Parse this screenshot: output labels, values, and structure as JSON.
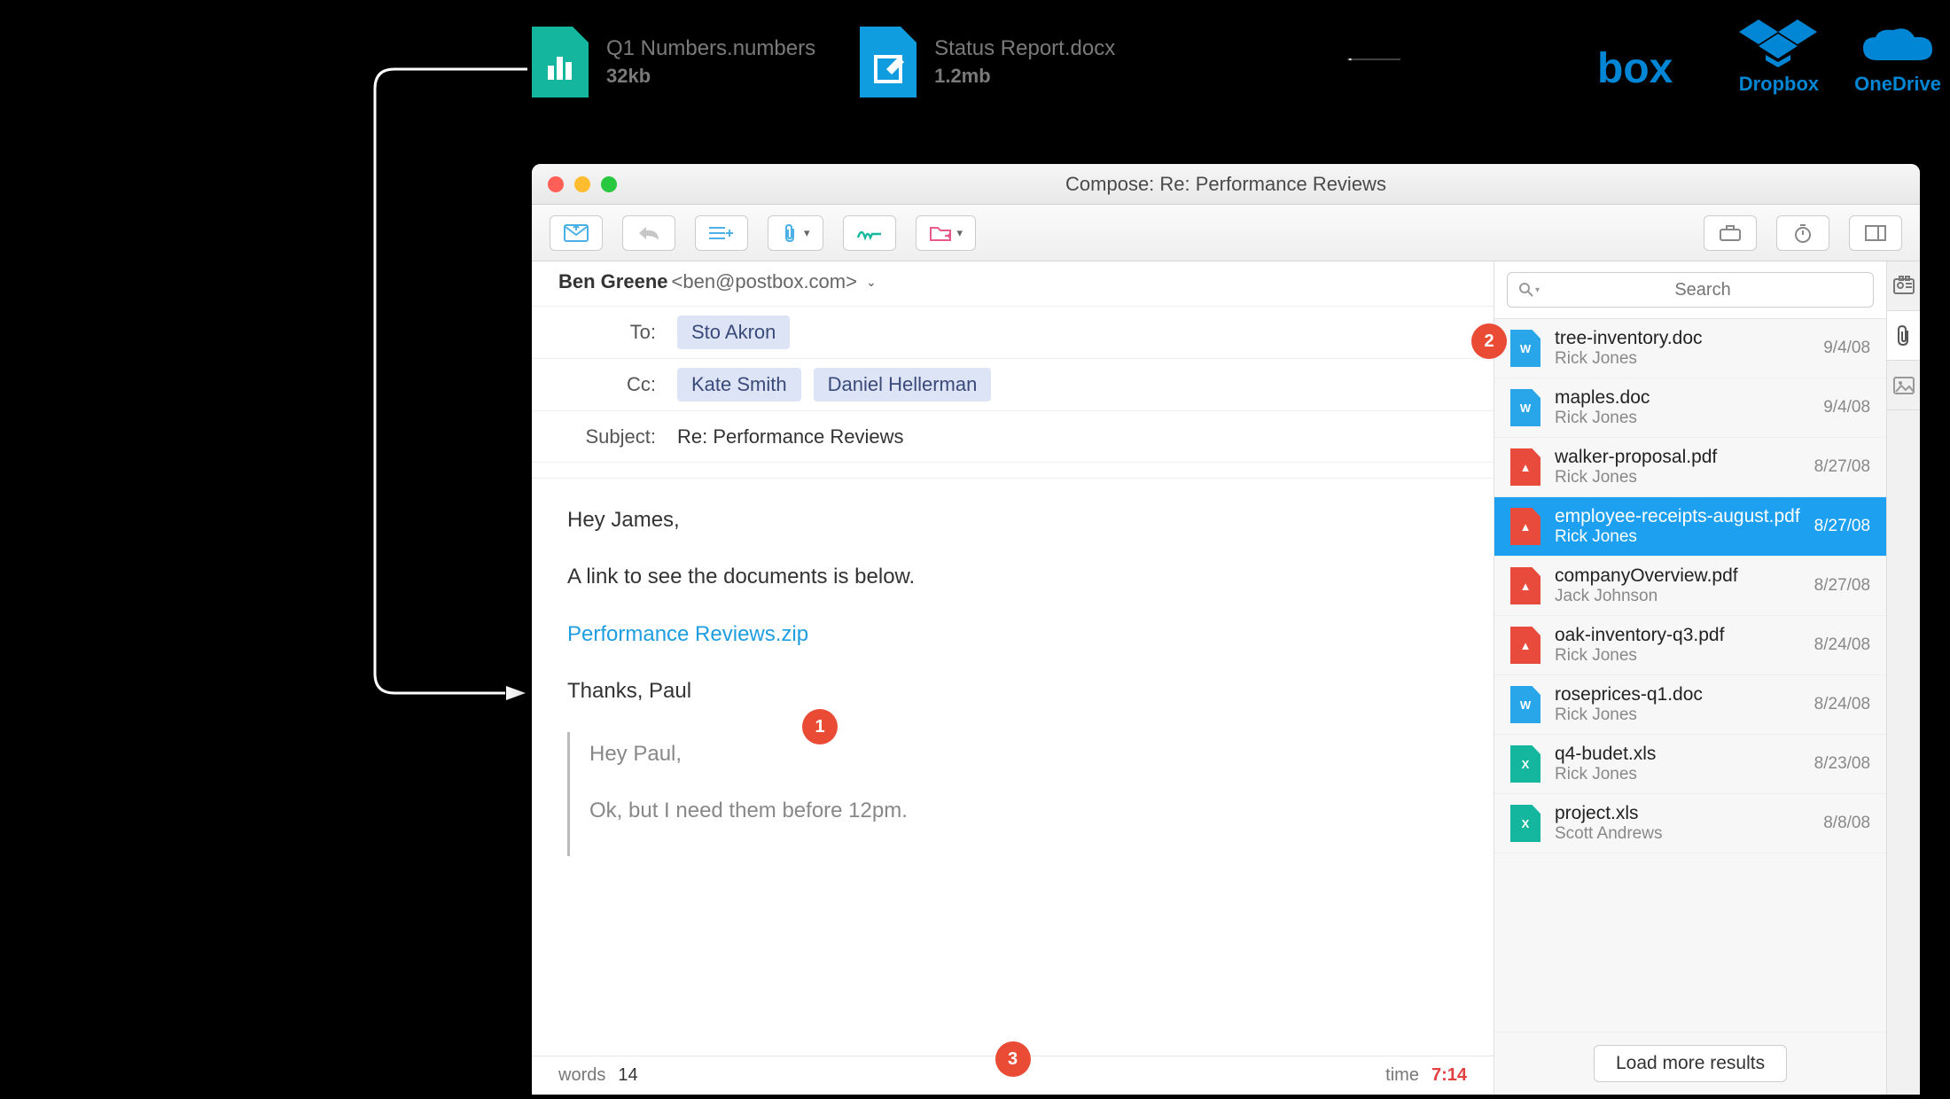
{
  "top_files": [
    {
      "name": "Q1 Numbers.numbers",
      "size": "32kb",
      "icon_color": "#14b79d",
      "glyph": "chart"
    },
    {
      "name": "Status Report.docx",
      "size": "1.2mb",
      "icon_color": "#0f9de0",
      "glyph": "edit"
    }
  ],
  "providers": [
    {
      "name": "box",
      "label": ""
    },
    {
      "name": "dropbox",
      "label": "Dropbox"
    },
    {
      "name": "onedrive",
      "label": "OneDrive"
    }
  ],
  "window": {
    "title": "Compose: Re: Performance Reviews",
    "from_name": "Ben Greene",
    "from_addr": "<ben@postbox.com>",
    "to": [
      "Sto Akron"
    ],
    "cc": [
      "Kate Smith",
      "Daniel Hellerman"
    ],
    "subject_label": "Subject:",
    "to_label": "To:",
    "cc_label": "Cc:",
    "subject": "Re: Performance Reviews",
    "body": {
      "greeting": "Hey James,",
      "line1": "A link to see the documents is below.",
      "link_text": "Performance Reviews.zip",
      "signoff": "Thanks, Paul",
      "quote_greeting": "Hey Paul,",
      "quote_line": "Ok, but I need them before 12pm."
    },
    "status": {
      "words_label": "words",
      "words": "14",
      "time_label": "time",
      "time": "7:14"
    }
  },
  "sidebar": {
    "search_placeholder": "Search",
    "load_more": "Load more results",
    "results": [
      {
        "file": "tree-inventory.doc",
        "author": "Rick Jones",
        "date": "9/4/08",
        "type": "doc",
        "selected": false
      },
      {
        "file": "maples.doc",
        "author": "Rick Jones",
        "date": "9/4/08",
        "type": "doc",
        "selected": false
      },
      {
        "file": "walker-proposal.pdf",
        "author": "Rick Jones",
        "date": "8/27/08",
        "type": "pdf",
        "selected": false
      },
      {
        "file": "employee-receipts-august.pdf",
        "author": "Rick Jones",
        "date": "8/27/08",
        "type": "pdf",
        "selected": true
      },
      {
        "file": "companyOverview.pdf",
        "author": "Jack Johnson",
        "date": "8/27/08",
        "type": "pdf",
        "selected": false
      },
      {
        "file": "oak-inventory-q3.pdf",
        "author": "Rick Jones",
        "date": "8/24/08",
        "type": "pdf",
        "selected": false
      },
      {
        "file": "roseprices-q1.doc",
        "author": "Rick Jones",
        "date": "8/24/08",
        "type": "doc",
        "selected": false
      },
      {
        "file": "q4-budet.xls",
        "author": "Rick Jones",
        "date": "8/23/08",
        "type": "xls",
        "selected": false
      },
      {
        "file": "project.xls",
        "author": "Scott Andrews",
        "date": "8/8/08",
        "type": "xls",
        "selected": false
      }
    ]
  },
  "callouts": {
    "c1": "1",
    "c2": "2",
    "c3": "3"
  }
}
